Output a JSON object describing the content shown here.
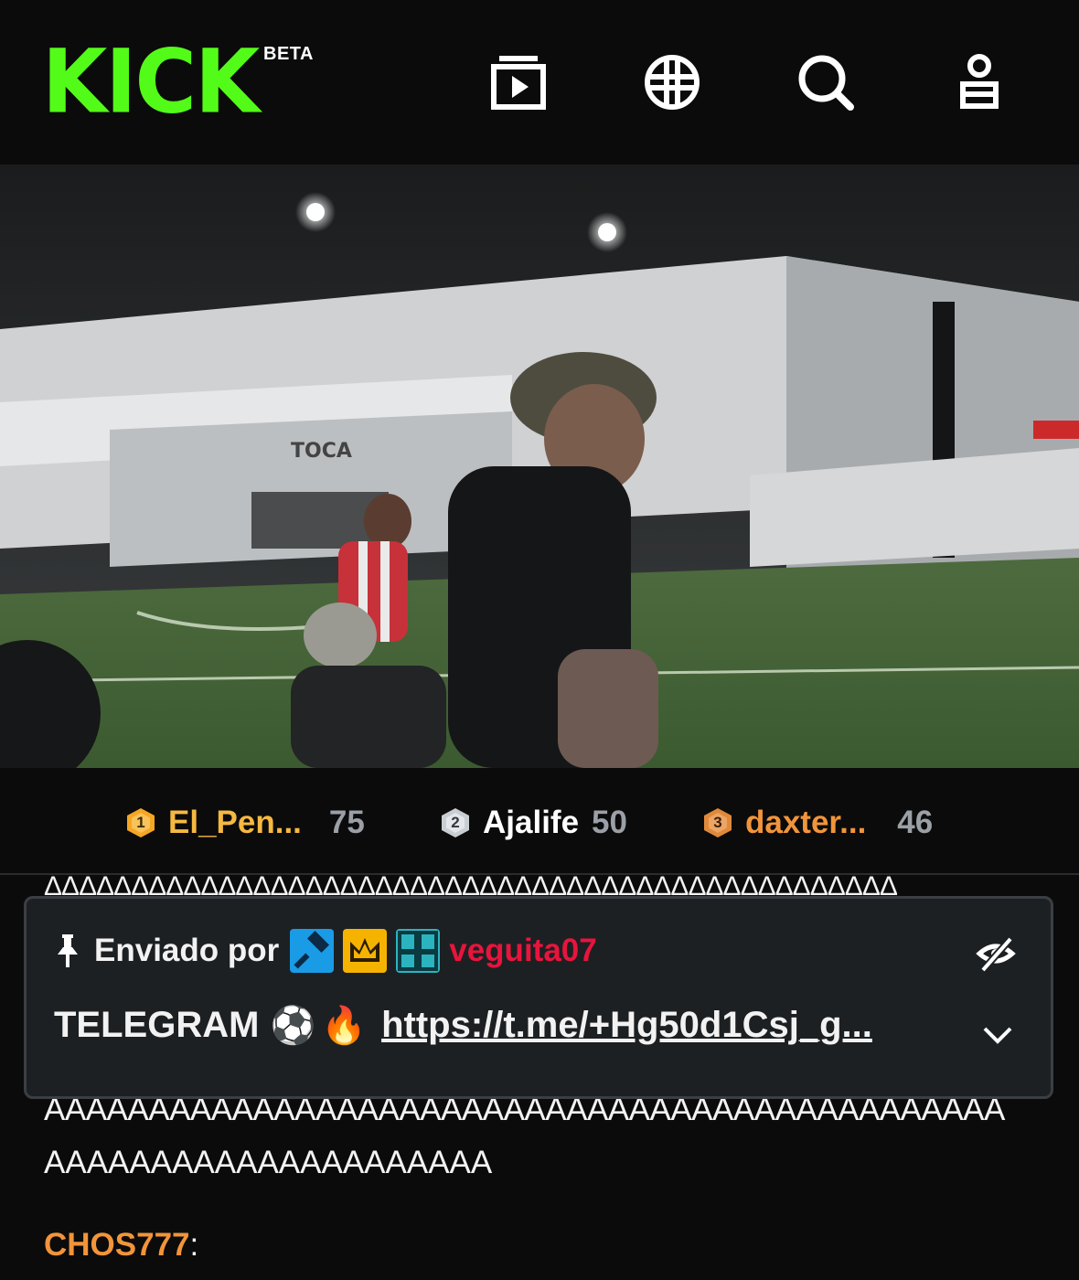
{
  "header": {
    "logo_text": "KICK",
    "beta_label": "BETA",
    "icons": [
      "following-icon",
      "browse-globe-icon",
      "search-icon",
      "profile-icon"
    ],
    "accent_color": "#53fc18"
  },
  "video": {
    "wall_text": "TOCA"
  },
  "leaderboard": [
    {
      "rank": "1",
      "name": "El_Pen...",
      "score": "75",
      "name_color": "#f5b940",
      "badge_color": "#f5a623"
    },
    {
      "rank": "2",
      "name": "Ajalife",
      "score": "50",
      "name_color": "#ffffff",
      "badge_color": "#c9ced3"
    },
    {
      "rank": "3",
      "name": "daxter...",
      "score": "46",
      "name_color": "#f2943a",
      "badge_color": "#e0893a"
    }
  ],
  "chat": {
    "line_top": "ΔΔΔΔΔΔΔΔΔΔΔΔΔΔΔΔΔΔΔΔΔΔΔΔΔΔΔΔΔΔΔΔΔΔΔΔΔΔΔΔΔΔΔΔΔΔΔΔΔ",
    "line_mid": "AAAAAAAAAAAAAAAAAAAAAAAAAAAAAAAAAAAAAAAAAAAAAA",
    "line_bottom": "AAAAAAAAAAAAAAAAAAAAA",
    "next_user": "CHOS777",
    "next_sep": ":"
  },
  "pinned": {
    "label": "Enviado por",
    "username": "veguita07",
    "username_color": "#e8143c",
    "badge_icons": [
      "moderator-badge-icon",
      "crown-badge-icon",
      "og-badge-icon"
    ],
    "message": "TELEGRAM",
    "emoji1": "⚽",
    "emoji2": "🔥",
    "link": "https://t.me/+Hg50d1Csj_g..."
  }
}
